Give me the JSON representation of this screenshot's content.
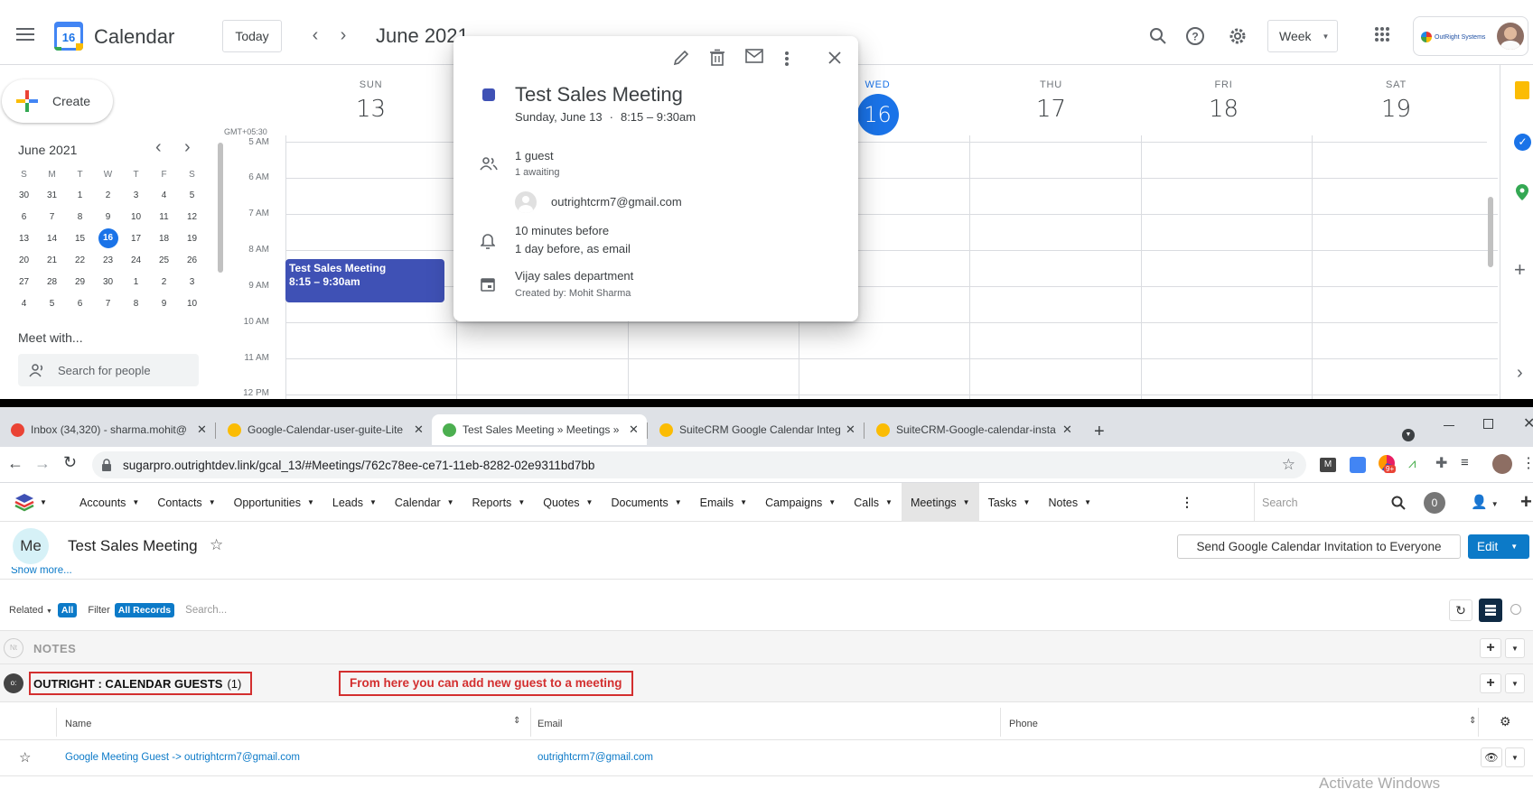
{
  "gcal": {
    "app_title": "Calendar",
    "logo_day": "16",
    "today_button": "Today",
    "month_title": "June 2021",
    "view_selector": "Week",
    "create_button": "Create",
    "mini_month": "June 2021",
    "weekday_initials": [
      "S",
      "M",
      "T",
      "W",
      "T",
      "F",
      "S"
    ],
    "mini_weeks": [
      [
        "30",
        "31",
        "1",
        "2",
        "3",
        "4",
        "5"
      ],
      [
        "6",
        "7",
        "8",
        "9",
        "10",
        "11",
        "12"
      ],
      [
        "13",
        "14",
        "15",
        "16",
        "17",
        "18",
        "19"
      ],
      [
        "20",
        "21",
        "22",
        "23",
        "24",
        "25",
        "26"
      ],
      [
        "27",
        "28",
        "29",
        "30",
        "1",
        "2",
        "3"
      ],
      [
        "4",
        "5",
        "6",
        "7",
        "8",
        "9",
        "10"
      ]
    ],
    "today_day": "16",
    "meet_with": "Meet with...",
    "search_people_placeholder": "Search for people",
    "timezone": "GMT+05:30",
    "time_labels": [
      "5 AM",
      "6 AM",
      "7 AM",
      "8 AM",
      "9 AM",
      "10 AM",
      "11 AM",
      "12 PM"
    ],
    "days": [
      {
        "name": "SUN",
        "date": "13"
      },
      {
        "name": "WED",
        "date": "16"
      },
      {
        "name": "THU",
        "date": "17"
      },
      {
        "name": "FRI",
        "date": "18"
      },
      {
        "name": "SAT",
        "date": "19"
      }
    ],
    "event": {
      "title": "Test Sales Meeting",
      "time": "8:15 – 9:30am"
    },
    "popup": {
      "title": "Test Sales Meeting",
      "date": "Sunday, June 13",
      "time": "8:15 – 9:30am",
      "guests_count": "1 guest",
      "guests_status": "1 awaiting",
      "guest_email": "outrightcrm7@gmail.com",
      "reminder_1": "10 minutes before",
      "reminder_2": "1 day before, as email",
      "calendar_name": "Vijay sales department",
      "created_by": "Created by: Mohit Sharma",
      "color": "#3f51b5"
    },
    "account_name": "OutRight Systems",
    "colors": {
      "today_blue": "#1a73e8",
      "event": "#3f51b5"
    }
  },
  "browser": {
    "tabs": [
      {
        "title": "Inbox (34,320) - sharma.mohit@",
        "color": "#ea4335",
        "icon": "gmail-icon"
      },
      {
        "title": "Google-Calendar-user-guite-Lite",
        "color": "#fbbc04",
        "icon": "drive-icon"
      },
      {
        "title": "Test Sales Meeting » Meetings »",
        "color": "#4caf50",
        "icon": "suitecrm-icon",
        "active": true
      },
      {
        "title": "SuiteCRM Google Calendar Integ",
        "color": "#fbbc04",
        "icon": "drive-icon"
      },
      {
        "title": "SuiteCRM-Google-calendar-insta",
        "color": "#fbbc04",
        "icon": "drive-icon"
      }
    ],
    "url": "sugarpro.outrightdev.link/gcal_13/#Meetings/762c78ee-ce71-11eb-8282-02e9311bd7bb",
    "extension_badge": "9+"
  },
  "crm": {
    "nav": [
      "Accounts",
      "Contacts",
      "Opportunities",
      "Leads",
      "Calendar",
      "Reports",
      "Quotes",
      "Documents",
      "Emails",
      "Campaigns",
      "Calls",
      "Meetings",
      "Tasks",
      "Notes"
    ],
    "active_nav": "Meetings",
    "search_placeholder": "Search",
    "notif_count": "0",
    "record_avatar": "Me",
    "record_title": "Test Sales Meeting",
    "send_invite_button": "Send Google Calendar Invitation to Everyone",
    "edit_button": "Edit",
    "show_more": "Show more...",
    "related_label": "Related",
    "all_badge": "All",
    "filter_label": "Filter",
    "all_records_badge": "All Records",
    "subpanel_search_placeholder": "Search...",
    "notes_icon": "Nt",
    "notes_title": "NOTES",
    "guests_icon": "o:",
    "guests_title": "OUTRIGHT : CALENDAR GUESTS",
    "guests_count": "(1)",
    "annotation": "From here you can add new guest to a meeting",
    "columns": [
      "Name",
      "Email",
      "Phone"
    ],
    "rows": [
      {
        "name": "Google Meeting Guest -> outrightcrm7@gmail.com",
        "email": "outrightcrm7@gmail.com",
        "phone": ""
      }
    ],
    "watermark": "Activate Windows",
    "colors": {
      "accent": "#0c7ac8",
      "annotation_red": "#d32f2f"
    }
  }
}
